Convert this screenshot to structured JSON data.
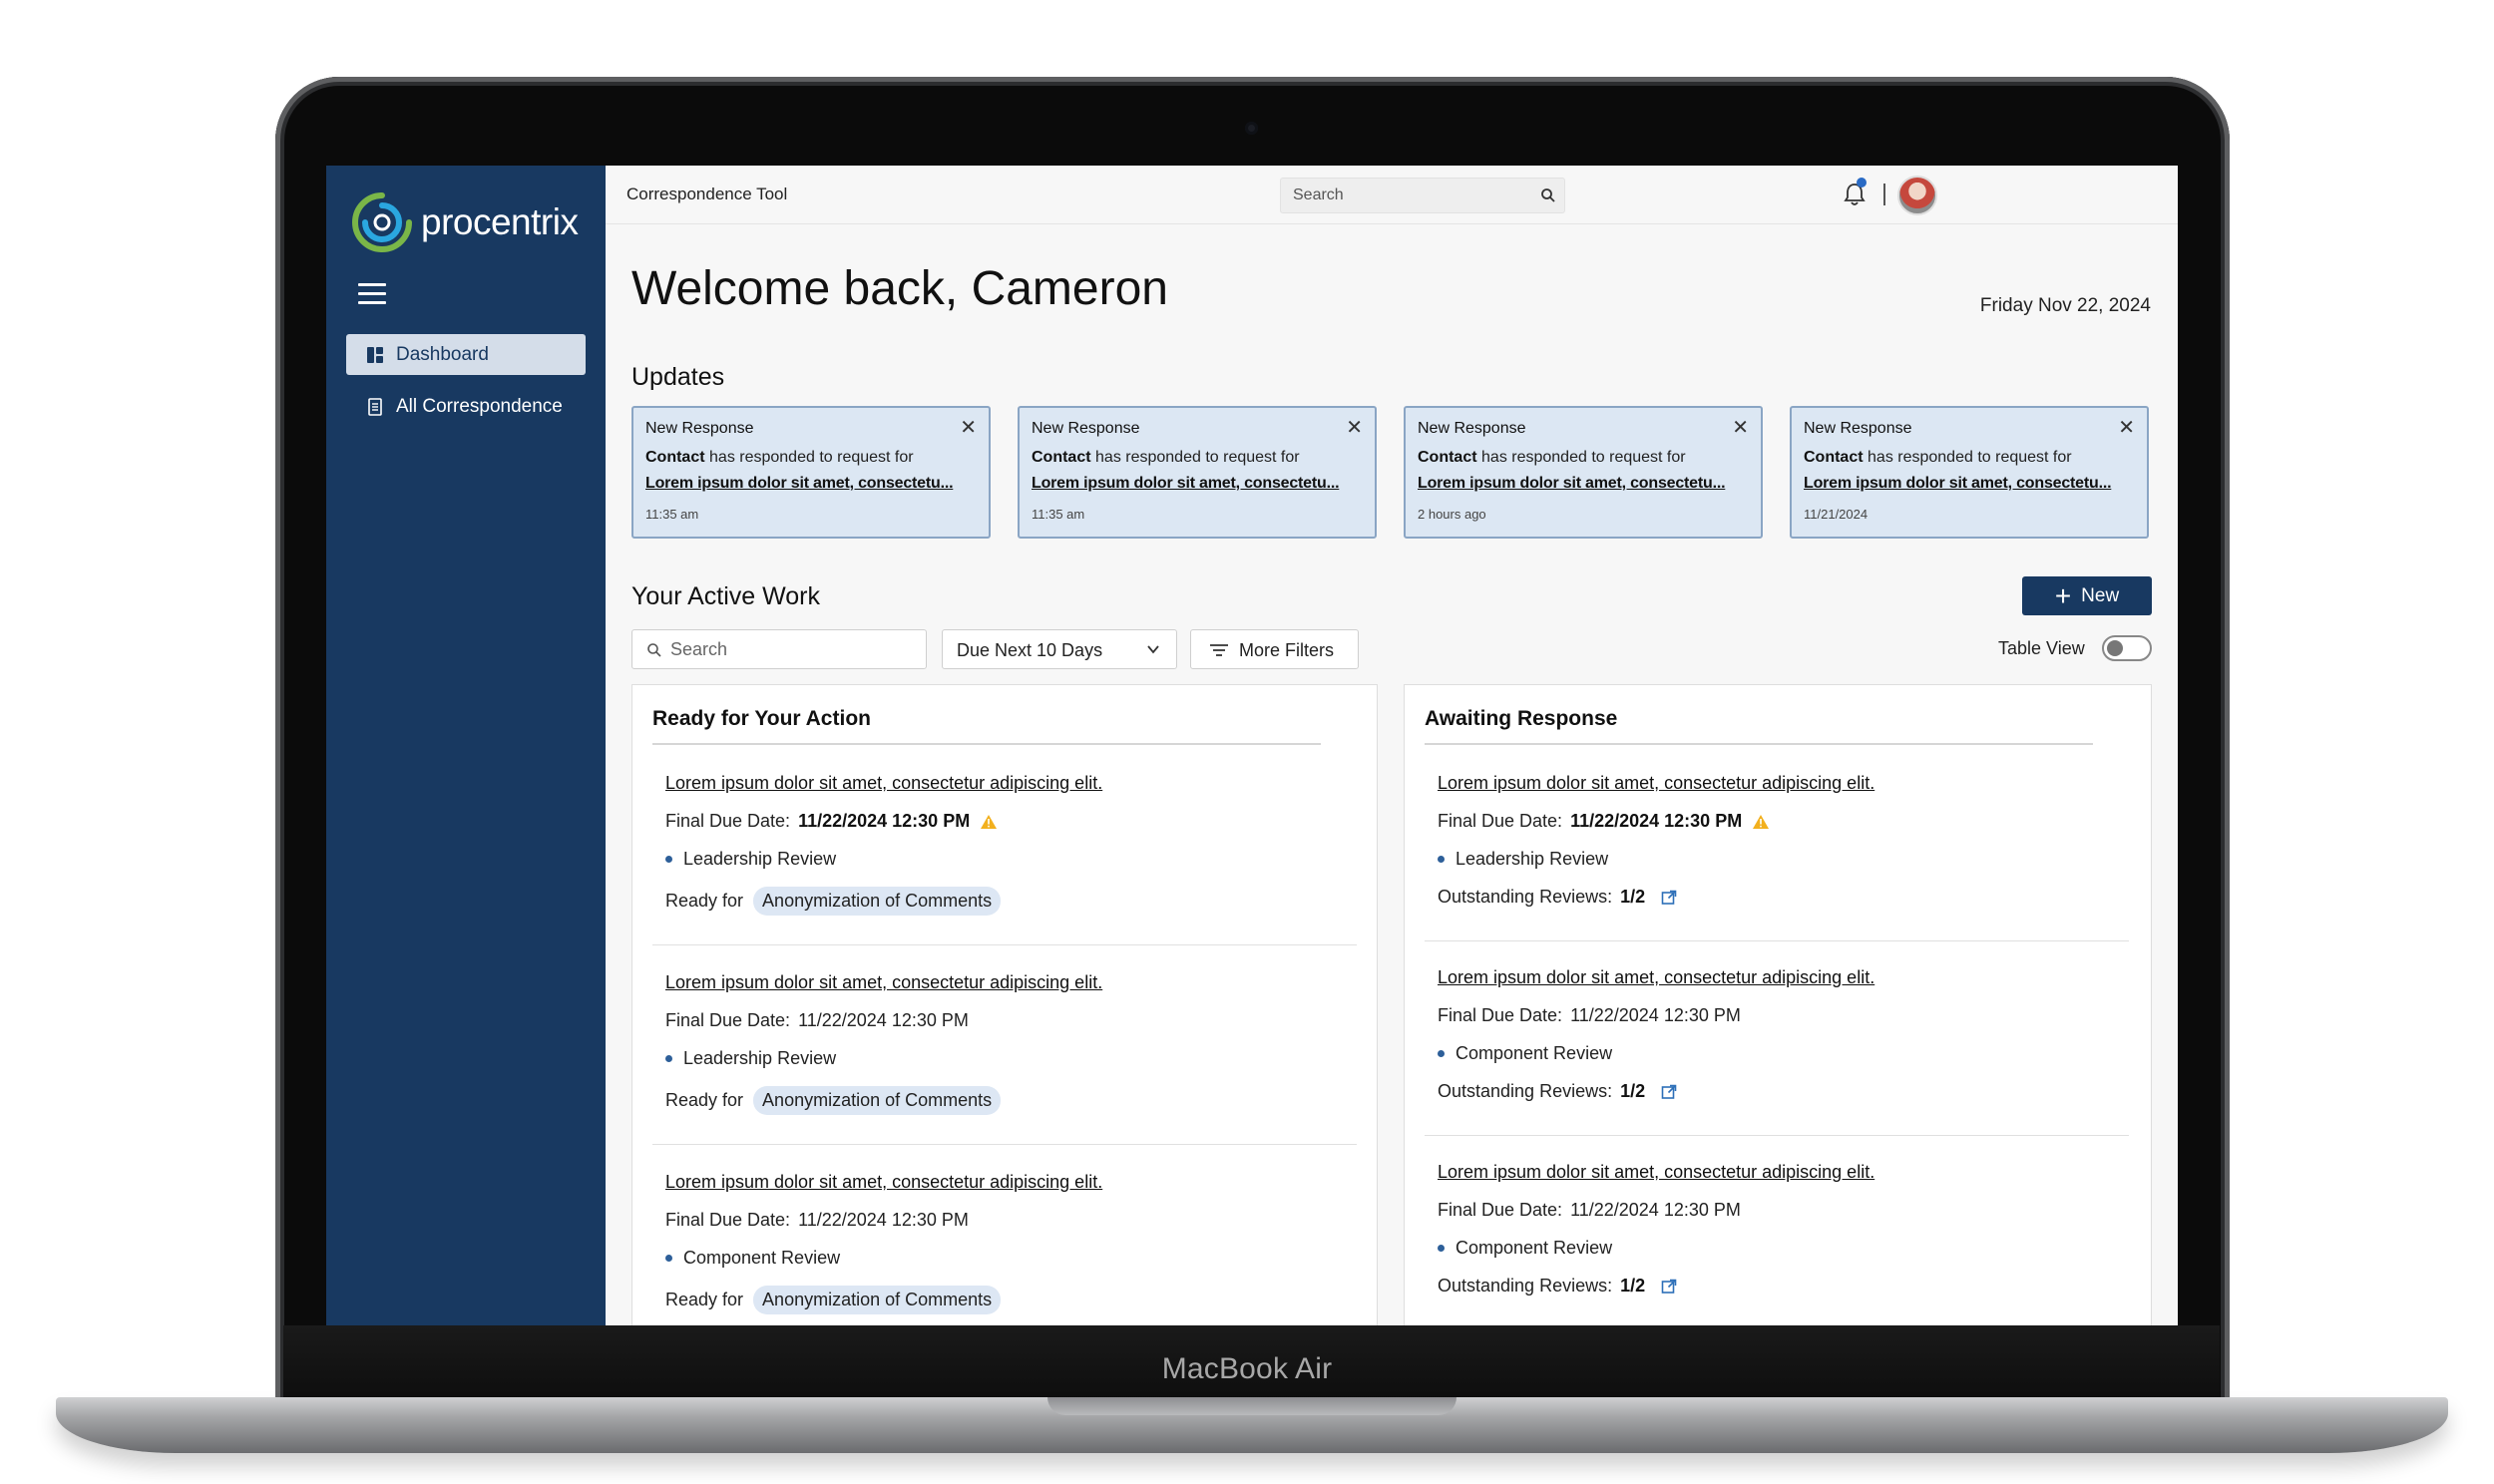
{
  "device": {
    "label": "MacBook Air"
  },
  "app": {
    "brand": "procentrix",
    "title": "Correspondence Tool",
    "search_placeholder": "Search"
  },
  "sidebar": {
    "items": [
      {
        "label": "Dashboard",
        "active": true,
        "icon": "dashboard-icon"
      },
      {
        "label": "All Correspondence",
        "active": false,
        "icon": "document-icon"
      }
    ]
  },
  "welcome": "Welcome back, Cameron",
  "date": "Friday Nov 22, 2024",
  "updates": {
    "heading": "Updates",
    "cards": [
      {
        "title": "New Response",
        "contact": "Contact",
        "text": "has responded to request for",
        "link": "Lorem ipsum dolor sit amet, consectetu...",
        "time": "11:35 am"
      },
      {
        "title": "New Response",
        "contact": "Contact",
        "text": "has responded to request for",
        "link": "Lorem ipsum dolor sit amet, consectetu...",
        "time": "11:35 am"
      },
      {
        "title": "New Response",
        "contact": "Contact",
        "text": "has responded to request for",
        "link": "Lorem ipsum dolor sit amet, consectetu...",
        "time": "2 hours ago"
      },
      {
        "title": "New Response",
        "contact": "Contact",
        "text": "has responded to request for",
        "link": "Lorem ipsum dolor sit amet, consectetu...",
        "time": "11/21/2024"
      }
    ]
  },
  "active_work": {
    "heading": "Your Active Work",
    "new_label": "New",
    "search_placeholder": "Search",
    "due_filter": "Due Next 10 Days",
    "more_filters": "More Filters",
    "table_view_label": "Table View",
    "table_view_on": false
  },
  "ready_panel": {
    "title": "Ready for Your Action",
    "items": [
      {
        "link": "Lorem ipsum dolor sit amet, consectetur adipiscing elit.",
        "due_label": "Final Due Date:",
        "due": "11/22/2024 12:30 PM",
        "warning": true,
        "stage": "Leadership Review",
        "ready_label": "Ready for",
        "ready_chip": "Anonymization of Comments"
      },
      {
        "link": "Lorem ipsum dolor sit amet, consectetur adipiscing elit.",
        "due_label": "Final Due Date:",
        "due": "11/22/2024 12:30 PM",
        "warning": false,
        "stage": "Leadership Review",
        "ready_label": "Ready for",
        "ready_chip": "Anonymization of Comments"
      },
      {
        "link": "Lorem ipsum dolor sit amet, consectetur adipiscing elit.",
        "due_label": "Final Due Date:",
        "due": "11/22/2024 12:30 PM",
        "warning": false,
        "stage": "Component Review",
        "ready_label": "Ready for",
        "ready_chip": "Anonymization of Comments"
      }
    ]
  },
  "awaiting_panel": {
    "title": "Awaiting Response",
    "items": [
      {
        "link": "Lorem ipsum dolor sit amet, consectetur adipiscing elit.",
        "due_label": "Final Due Date:",
        "due": "11/22/2024 12:30 PM",
        "warning": true,
        "stage": "Leadership Review",
        "outstanding_label": "Outstanding Reviews:",
        "outstanding": "1/2"
      },
      {
        "link": "Lorem ipsum dolor sit amet, consectetur adipiscing elit.",
        "due_label": "Final Due Date:",
        "due": "11/22/2024 12:30 PM",
        "warning": false,
        "stage": "Component Review",
        "outstanding_label": "Outstanding Reviews:",
        "outstanding": "1/2"
      },
      {
        "link": "Lorem ipsum dolor sit amet, consectetur adipiscing elit.",
        "due_label": "Final Due Date:",
        "due": "11/22/2024 12:30 PM",
        "warning": false,
        "stage": "Component Review",
        "outstanding_label": "Outstanding Reviews:",
        "outstanding": "1/2"
      }
    ]
  },
  "colors": {
    "sidebar": "#183961",
    "accent": "#183961",
    "card_bg": "#dce7f3",
    "chip_bg": "#dde7f4",
    "warning": "#f2b01e",
    "logo_green": "#7ab648",
    "logo_blue": "#2aa7e0"
  }
}
